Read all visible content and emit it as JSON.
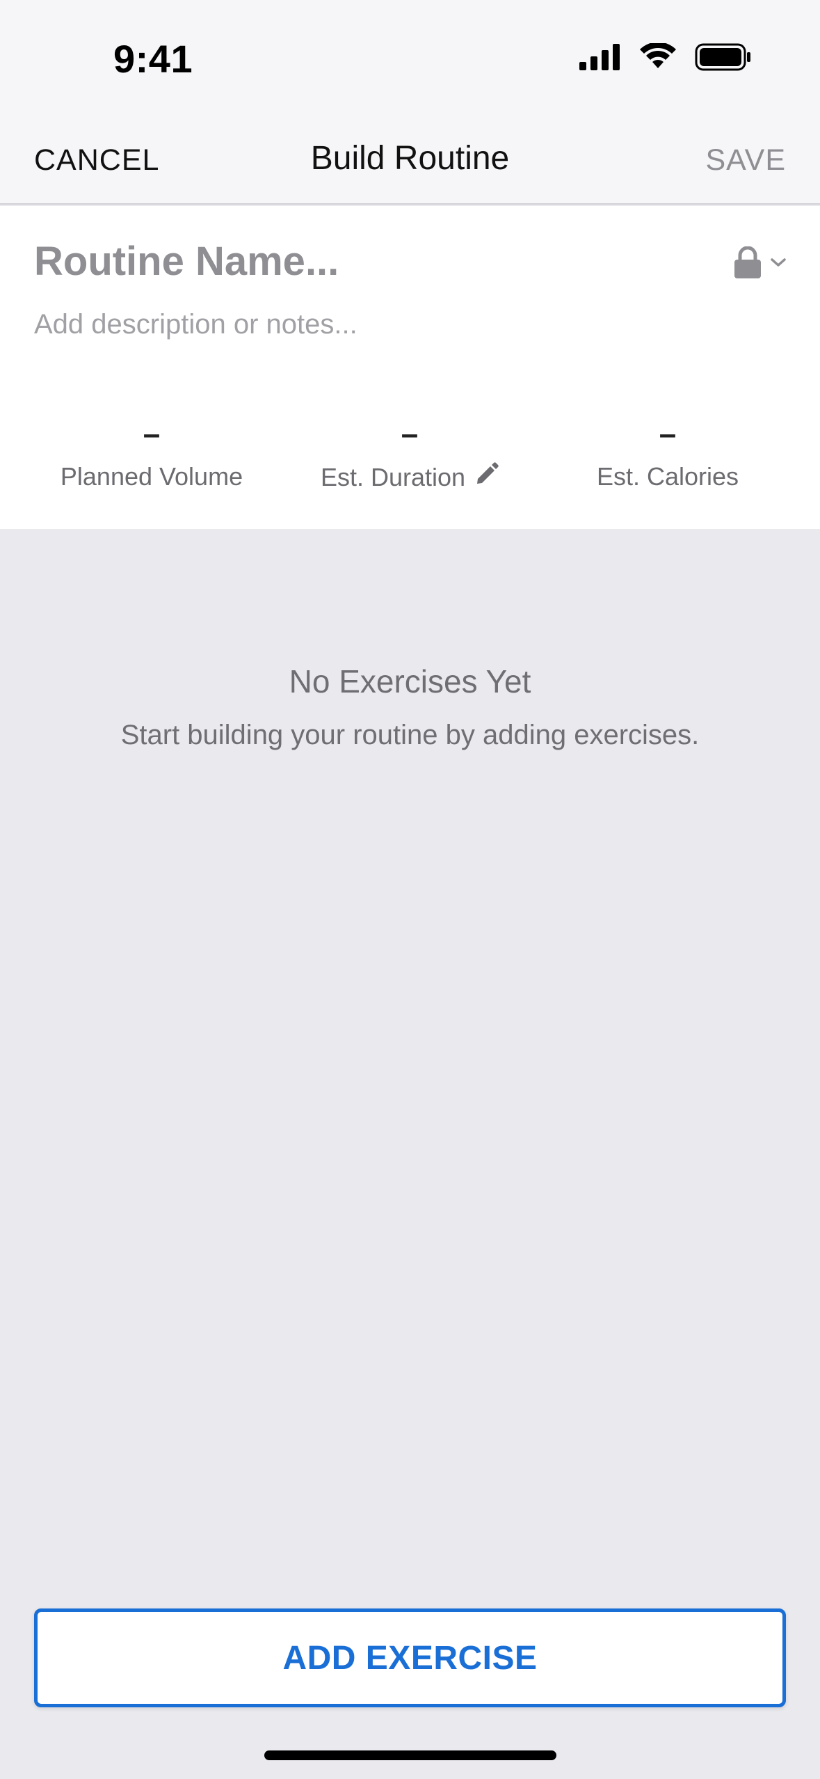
{
  "status_bar": {
    "time": "9:41"
  },
  "nav": {
    "cancel_label": "CANCEL",
    "title": "Build Routine",
    "save_label": "SAVE"
  },
  "routine": {
    "name_placeholder": "Routine Name...",
    "description_placeholder": "Add description or notes...",
    "visibility_icon": "lock-icon"
  },
  "stats": [
    {
      "value": "–",
      "label": "Planned Volume"
    },
    {
      "value": "–",
      "label": "Est. Duration",
      "icon": "pencil-icon"
    },
    {
      "value": "–",
      "label": "Est. Calories"
    }
  ],
  "empty_state": {
    "title": "No Exercises Yet",
    "subtitle": "Start building your routine by adding exercises."
  },
  "actions": {
    "add_exercise_label": "ADD EXERCISE"
  },
  "colors": {
    "accent": "#1a6fd6",
    "background": "#e9e9ee",
    "muted_text": "#8e8e93"
  }
}
